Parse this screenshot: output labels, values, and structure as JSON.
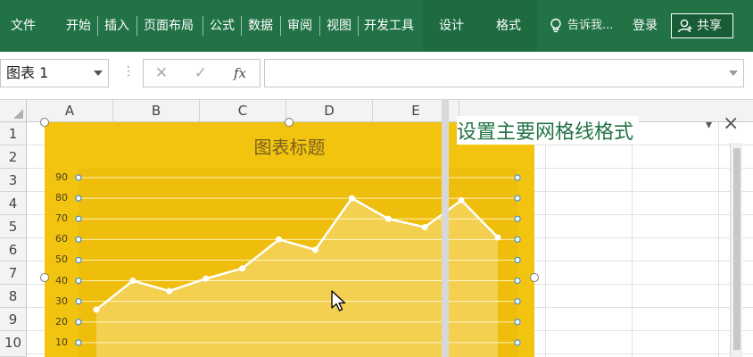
{
  "ribbon": {
    "tabs": [
      "文件",
      "开始",
      "插入",
      "页面布局",
      "公式",
      "数据",
      "审阅",
      "视图",
      "开发工具"
    ],
    "context_tabs": [
      "设计",
      "格式"
    ],
    "tell_me": "告诉我...",
    "login": "登录",
    "share": "共享"
  },
  "formula_bar": {
    "name_box": "图表 1",
    "cancel_symbol": "✕",
    "enter_symbol": "✓",
    "fx_symbol": "fx",
    "formula": ""
  },
  "sheet": {
    "columns": [
      "A",
      "B",
      "C",
      "D",
      "E"
    ],
    "rows": [
      "1",
      "2",
      "3",
      "4",
      "5",
      "6",
      "7",
      "8",
      "9",
      "10"
    ]
  },
  "chart": {
    "title": "图表标题"
  },
  "chart_data": {
    "type": "area",
    "title": "图表标题",
    "xlabel": "",
    "ylabel": "",
    "ylim": [
      0,
      90
    ],
    "yticks": [
      10,
      20,
      30,
      40,
      50,
      60,
      70,
      80,
      90
    ],
    "x": [
      1,
      2,
      3,
      4,
      5,
      6,
      7,
      8,
      9,
      10,
      11,
      12
    ],
    "series": [
      {
        "values": [
          26,
          40,
          35,
          41,
          46,
          60,
          55,
          80,
          70,
          66,
          79,
          61
        ]
      }
    ],
    "grid": true,
    "legend": "none",
    "colors": {
      "background": "#f2c40f",
      "line": "#ffffff",
      "gridline": "#fff2b8"
    }
  },
  "format_pane": {
    "title": "设置主要网格线格式",
    "options_symbol": "▾",
    "close_symbol": "×"
  },
  "colors": {
    "ribbon": "#217346",
    "chart_background": "#f2c40f",
    "pane_title": "#217346"
  }
}
